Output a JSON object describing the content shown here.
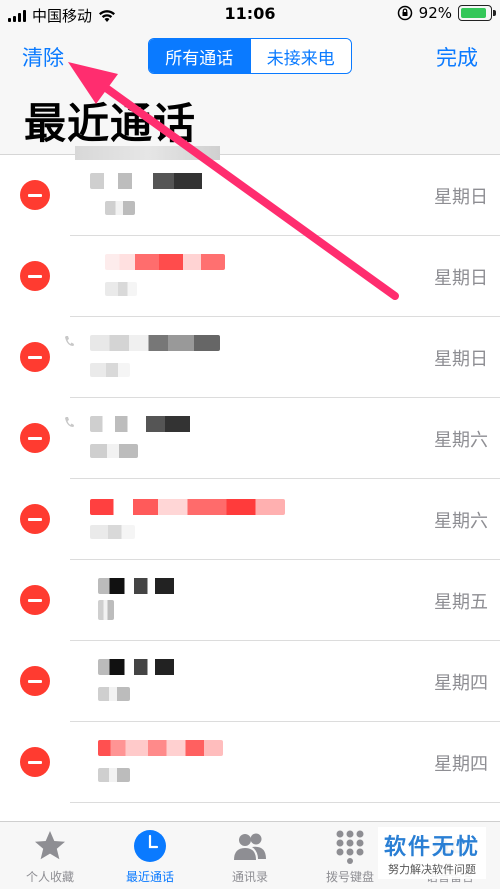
{
  "status_bar": {
    "carrier": "中国移动",
    "time": "11:06",
    "battery_percent": "92%",
    "battery_level": 0.92
  },
  "nav": {
    "clear_label": "清除",
    "done_label": "完成",
    "segments": [
      "所有通话",
      "未接来电"
    ],
    "active_segment": "所有通话"
  },
  "title": "最近通话",
  "calls": [
    {
      "day": "星期日",
      "missed": false
    },
    {
      "day": "星期日",
      "missed": true
    },
    {
      "day": "星期日",
      "missed": false
    },
    {
      "day": "星期六",
      "missed": false
    },
    {
      "day": "星期六",
      "missed": true
    },
    {
      "day": "星期五",
      "missed": false
    },
    {
      "day": "星期四",
      "missed": false
    },
    {
      "day": "星期四",
      "missed": true
    }
  ],
  "tabs": [
    {
      "label": "个人收藏",
      "icon": "star-icon"
    },
    {
      "label": "最近通话",
      "icon": "clock-icon",
      "active": true
    },
    {
      "label": "通讯录",
      "icon": "contacts-icon"
    },
    {
      "label": "拨号键盘",
      "icon": "keypad-icon"
    },
    {
      "label": "语音留言",
      "icon": "voicemail-icon"
    }
  ],
  "watermark": {
    "main": "软件无忧",
    "sub": "努力解决软件问题"
  },
  "colors": {
    "accent": "#0a7aff",
    "delete": "#ff3b30",
    "annotation_arrow": "#ff2d6f"
  }
}
